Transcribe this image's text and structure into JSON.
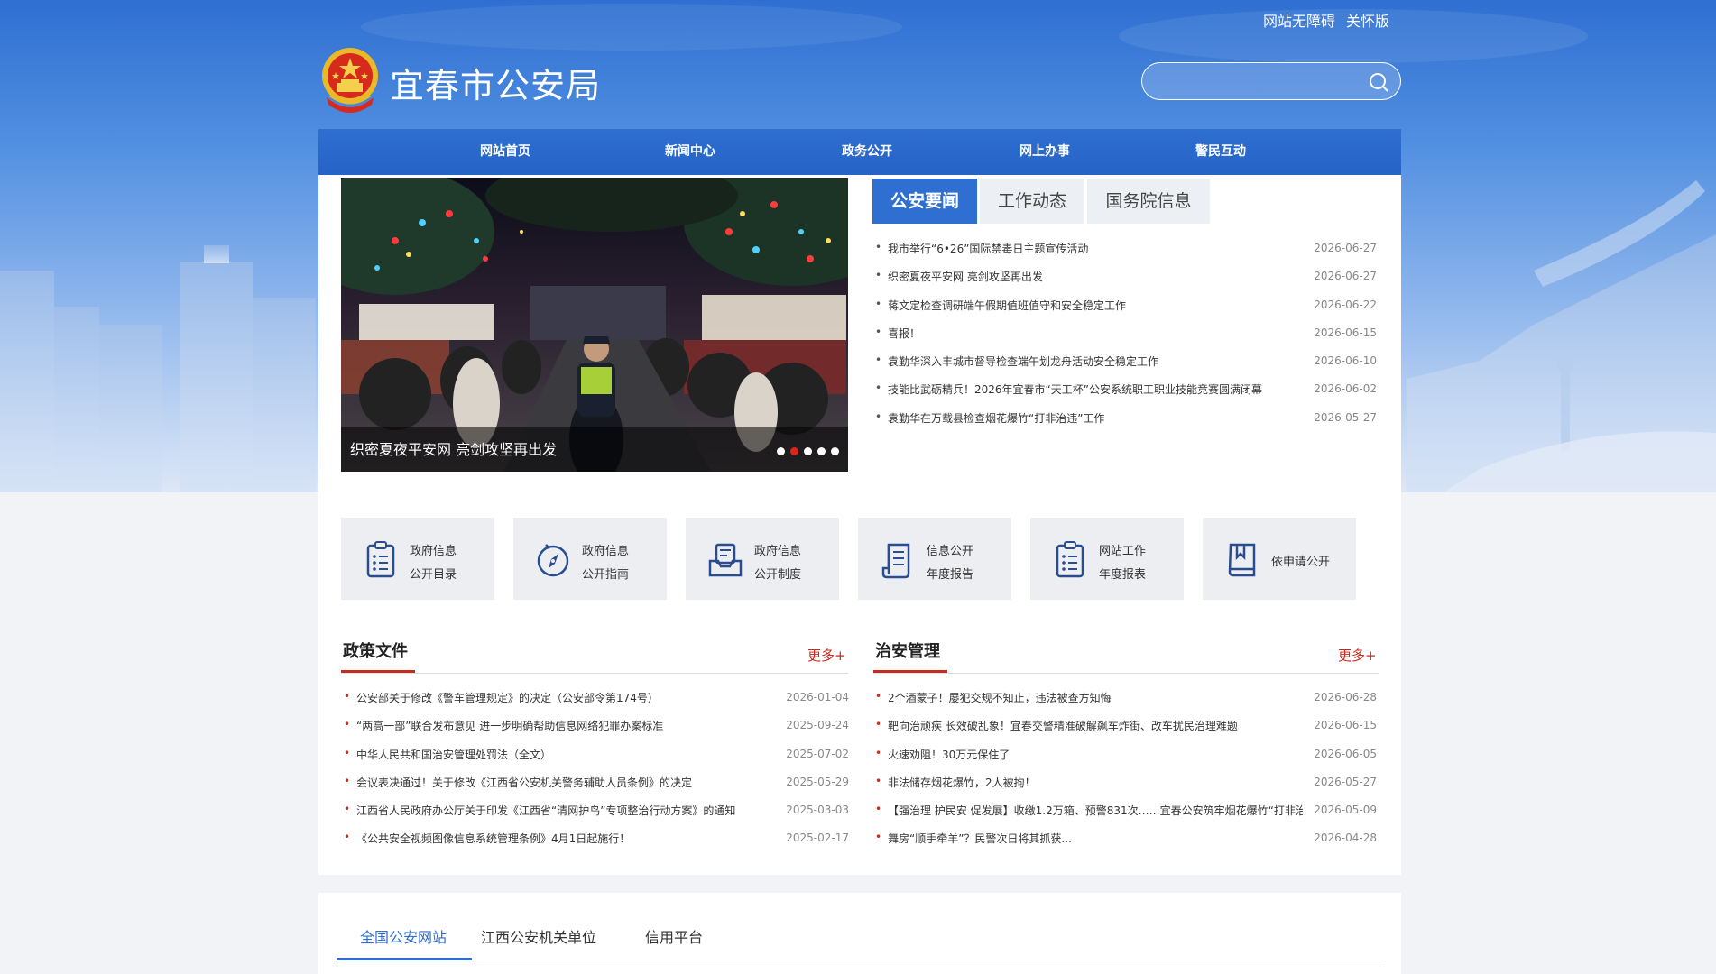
{
  "top_links": [
    "网站无障碍",
    "关怀版"
  ],
  "header": {
    "title": "宜春市公安局"
  },
  "search": {
    "value": "",
    "placeholder": ""
  },
  "nav": [
    "网站首页",
    "新闻中心",
    "政务公开",
    "网上办事",
    "警民互动"
  ],
  "carousel": {
    "caption": "织密夏夜平安网 亮剑攻坚再出发",
    "dot_count": 5,
    "active_dot": 2
  },
  "news_tabs": [
    "公安要闻",
    "工作动态",
    "国务院信息"
  ],
  "news_list": [
    {
      "title": "我市举行“6•26”国际禁毒日主题宣传活动",
      "date": "2026-06-27"
    },
    {
      "title": "织密夏夜平安网 亮剑攻坚再出发",
      "date": "2026-06-27"
    },
    {
      "title": "蒋文定检查调研端午假期值班值守和安全稳定工作",
      "date": "2026-06-22"
    },
    {
      "title": "喜报！",
      "date": "2026-06-15"
    },
    {
      "title": "袁勤华深入丰城市督导检查端午划龙舟活动安全稳定工作",
      "date": "2026-06-10"
    },
    {
      "title": "技能比武砺精兵！2026年宜春市“天工杯”公安系统职工职业技能竞赛圆满闭幕",
      "date": "2026-06-02"
    },
    {
      "title": "袁勤华在万载县检查烟花爆竹“打非治违”工作",
      "date": "2026-05-27"
    }
  ],
  "quick_cards": [
    {
      "line1": "政府信息",
      "line2": "公开目录",
      "icon": "list-doc-icon"
    },
    {
      "line1": "政府信息",
      "line2": "公开指南",
      "icon": "compass-icon"
    },
    {
      "line1": "政府信息",
      "line2": "公开制度",
      "icon": "tray-doc-icon"
    },
    {
      "line1": "信息公开",
      "line2": "年度报告",
      "icon": "scroll-doc-icon"
    },
    {
      "line1": "网站工作",
      "line2": "年度报表",
      "icon": "list-doc-icon"
    },
    {
      "line1": "依申请公开",
      "line2": "",
      "icon": "bookmark-book-icon"
    }
  ],
  "policy": {
    "title": "政策文件",
    "more": "更多+",
    "items": [
      {
        "title": "公安部关于修改《警车管理规定》的决定（公安部令第174号）",
        "date": "2026-01-04"
      },
      {
        "title": "“两高一部”联合发布意见 进一步明确帮助信息网络犯罪办案标准",
        "date": "2025-09-24"
      },
      {
        "title": "中华人民共和国治安管理处罚法（全文）",
        "date": "2025-07-02"
      },
      {
        "title": "会议表决通过！关于修改《江西省公安机关警务辅助人员条例》的决定",
        "date": "2025-05-29"
      },
      {
        "title": "江西省人民政府办公厅关于印发《江西省“清网护鸟”专项整治行动方案》的通知",
        "date": "2025-03-03"
      },
      {
        "title": "《公共安全视频图像信息系统管理条例》4月1日起施行！",
        "date": "2025-02-17"
      }
    ]
  },
  "security": {
    "title": "治安管理",
    "more": "更多+",
    "items": [
      {
        "title": "2个酒蒙子！屡犯交规不知止，违法被查方知悔",
        "date": "2026-06-28"
      },
      {
        "title": "靶向治顽疾 长效破乱象！宜春交警精准破解飙车炸街、改车扰民治理难题",
        "date": "2026-06-15"
      },
      {
        "title": "火速劝阻！30万元保住了",
        "date": "2026-06-05"
      },
      {
        "title": "非法储存烟花爆竹，2人被拘！",
        "date": "2026-05-27"
      },
      {
        "title": "【强治理 护民安 促发展】收缴1.2万箱、预警831次……宜春公安筑牢烟花爆竹“打非治...",
        "date": "2026-05-09"
      },
      {
        "title": "舞房“顺手牵羊”？民警次日将其抓获...",
        "date": "2026-04-28"
      }
    ]
  },
  "link_tabs": [
    "全国公安网站",
    "江西公安机关单位",
    "信用平台"
  ],
  "colors": {
    "primary": "#2f6fd1",
    "accent_red": "#c62b1f",
    "card_bg": "#eceef2"
  }
}
